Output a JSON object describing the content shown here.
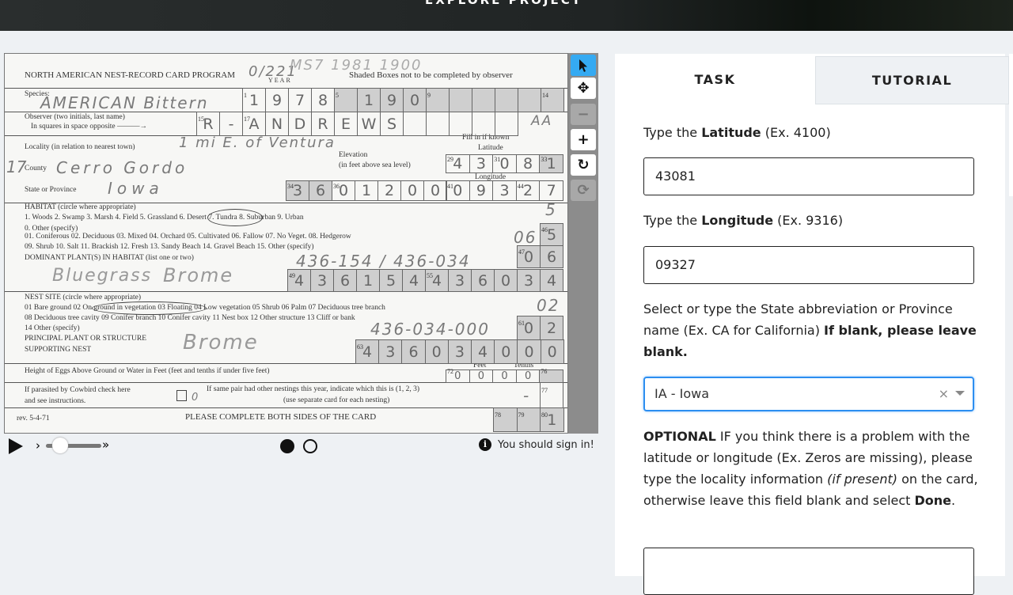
{
  "header": {
    "title": "EXPLORE PROJECT"
  },
  "card": {
    "printed": {
      "title": "NORTH AMERICAN NEST-RECORD CARD PROGRAM",
      "year": "YEAR",
      "shaded_note": "Shaded Boxes not to be completed by observer",
      "species": "Species:",
      "observer1": "Observer (two initials, last name)",
      "observer2": "In squares in space opposite ———→",
      "locality": "Locality (in relation to nearest town)",
      "county": "County",
      "state": "State or Province",
      "fill_known": "Fill in if known",
      "latitude": "Latitude",
      "longitude": "Longitude",
      "elevation1": "Elevation",
      "elevation2": "(in feet above sea level)",
      "habitat": "HABITAT (circle where appropriate)",
      "habitat1": "1. Woods  2. Swamp  3. Marsh  4. Field  5. Grassland  6. Desert  7. Tundra  8. Suburban  9. Urban",
      "habitat2": "0. Other (specify)",
      "habitat3": "01. Coniferous  02. Deciduous  03. Mixed  04. Orchard  05. Cultivated  06. Fallow  07. No Veget.  08. Hedgerow",
      "habitat4": "09. Shrub  10. Salt  11. Brackish  12. Fresh  13. Sandy Beach  14. Gravel Beach  15. Other (specify)",
      "dominant": "DOMINANT PLANT(S) IN HABITAT (list one or two)",
      "nest": "NEST SITE (circle where appropriate)",
      "nest1": "01 Bare ground  02 On ground in vegetation  03 Floating  04 Low vegetation  05 Shrub  06 Palm  07 Deciduous tree branch",
      "nest2": "08 Deciduous tree cavity  09 Conifer branch  10 Conifer cavity  11 Nest box  12 Other structure  13 Cliff or bank",
      "nest3": "14 Other (specify)",
      "principal1": "PRINCIPAL PLANT OR STRUCTURE",
      "principal2": "SUPPORTING NEST",
      "height": "Height of Eggs Above Ground or Water in Feet (feet and tenths if under five feet)",
      "feet": "Feet",
      "tenths": "Tenths",
      "cowbird1": "If parasited by Cowbird check here",
      "cowbird2": "and see instructions.",
      "nestings1": "If same pair had other nestings this year, indicate which this is (1, 2, 3)",
      "nestings2": "(use separate card for each nesting)",
      "rev": "rev. 5-4-71",
      "complete": "PLEASE COMPLETE BOTH SIDES OF THE CARD"
    },
    "handwritten": {
      "card_no": "0/221",
      "stamp": "MS7 1981 1900",
      "species": "AMERICAN Bittern",
      "locality": "1 mi E. of Ventura",
      "county_no": "17",
      "county": "Cerro Gordo",
      "state": "Iowa",
      "initials": "AA",
      "habitat_code": "5",
      "habitat_sub": "06",
      "plants_code": "436-154 / 436-034",
      "plant1": "Bluegrass",
      "plant2": "Brome",
      "nest_code": "02",
      "nest_plant_code": "436-034-000",
      "nest_plant": "Brome",
      "cowbird": "0",
      "nesting": "-"
    },
    "boxes": {
      "species": [
        "1",
        "9",
        "7",
        "8",
        "",
        "1",
        "9",
        "0",
        "",
        "",
        "",
        "",
        "",
        ""
      ],
      "observer": [
        "R",
        "-",
        "A",
        "N",
        "D",
        "R",
        "E",
        "W",
        "S",
        "",
        "",
        "",
        "",
        ""
      ],
      "latitude": [
        "4",
        "3",
        "0",
        "8",
        "1"
      ],
      "state_code": [
        "3",
        "6"
      ],
      "elevation": [
        "0",
        "1",
        "2",
        "0",
        "0"
      ],
      "longitude": [
        "0",
        "9",
        "3",
        "2",
        "7"
      ],
      "habitat_46": [
        "5"
      ],
      "habitat_47": [
        "0",
        "6"
      ],
      "plants": [
        "4",
        "3",
        "6",
        "1",
        "5",
        "4",
        "4",
        "3",
        "6",
        "0",
        "3",
        "4"
      ],
      "nest_61": [
        "0",
        "2"
      ],
      "nest_63": [
        "4",
        "3",
        "6",
        "0",
        "3",
        "4",
        "0",
        "0",
        "0"
      ],
      "height": [
        "0",
        "0",
        "0",
        "0",
        ""
      ],
      "nesting_77": [
        ""
      ],
      "end": [
        "",
        "",
        "1"
      ]
    },
    "box_labels": {
      "1": "1",
      "5": "5",
      "9": "9",
      "14": "14",
      "15": "15",
      "17": "17",
      "29": "29",
      "31": "31",
      "33": "33",
      "34": "34",
      "36": "36",
      "41": "41",
      "44": "44",
      "46": "46",
      "47": "47",
      "49": "49",
      "55": "55",
      "61": "61",
      "63": "63",
      "72": "72",
      "76": "76",
      "77": "77",
      "78": "78",
      "79": "79",
      "80": "80"
    }
  },
  "toolbar": {
    "pointer": "pointer-icon",
    "move": "move-icon",
    "zoom_out": "minus-icon",
    "zoom_in": "plus-icon",
    "rotate": "rotate-icon",
    "reset": "reset-icon"
  },
  "controls": {
    "sign_in": "You should sign in!"
  },
  "panel": {
    "tabs": [
      "TASK",
      "TUTORIAL"
    ],
    "lat_pre": "Type the ",
    "lat_bold": "Latitude",
    "lat_post": " (Ex. 4100)",
    "lat_value": "43081",
    "lon_pre": "Type the ",
    "lon_bold": "Longitude",
    "lon_post": " (Ex. 9316)",
    "lon_value": "09327",
    "state_text": "Select or type the State abbreviation or Province name (Ex. CA for California) ",
    "state_bold": "If blank, please leave blank.",
    "state_value": "IA - Iowa",
    "opt_bold": "OPTIONAL",
    "opt_text": " IF you think there is a problem with the latitude or longitude (Ex. Zeros are missing), please type the locality information ",
    "opt_italic": "(if present)",
    "opt_text2": " on the card, otherwise leave this field blank and select ",
    "opt_done": "Done",
    "opt_end": ".",
    "locality_value": ""
  },
  "colors": {
    "accent": "#2c8ef0",
    "active_tool": "#35aaf2",
    "page_bg": "#eef1f4"
  }
}
